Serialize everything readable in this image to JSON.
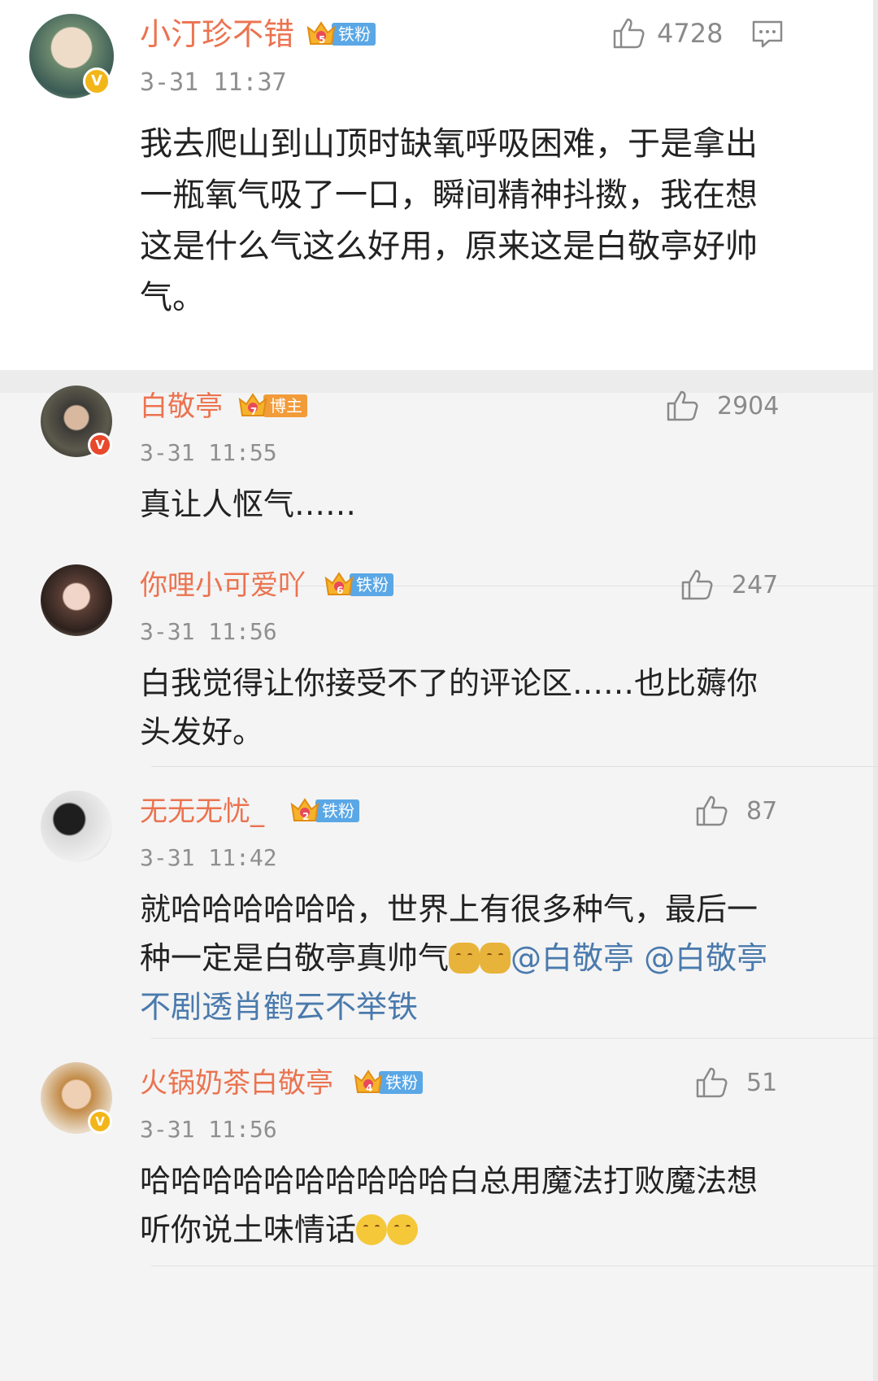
{
  "main_comment": {
    "username": "小汀珍不错",
    "fan_level": "5",
    "fan_tag": "铁粉",
    "time": "3-31 11:37",
    "likes": "4728",
    "text": "我去爬山到山顶时缺氧呼吸困难，于是拿出一瓶氧气吸了一口，瞬间精神抖擞，我在想这是什么气这么好用，原来这是白敬亭好帅气。"
  },
  "replies": [
    {
      "username": "白敬亭",
      "fan_level": "7",
      "fan_tag": "博主",
      "time": "3-31 11:55",
      "likes": "2904",
      "text": "真让人怄气……"
    },
    {
      "username": "你哩小可爱吖",
      "fan_level": "6",
      "fan_tag": "铁粉",
      "time": "3-31 11:56",
      "likes": "247",
      "text": "白我觉得让你接受不了的评论区……也比薅你头发好。"
    },
    {
      "username": "无无无忧_",
      "fan_level": "2",
      "fan_tag": "铁粉",
      "time": "3-31 11:42",
      "likes": "87",
      "text_a": "就哈哈哈哈哈哈，世界上有很多种气，最后一种一定是白敬亭真帅气",
      "mention_a": "@白敬亭",
      "mention_b": "@白敬亭不剧透肖鹤云不举铁"
    },
    {
      "username": "火锅奶茶白敬亭",
      "fan_level": "4",
      "fan_tag": "铁粉",
      "time": "3-31 11:56",
      "likes": "51",
      "text": "哈哈哈哈哈哈哈哈哈哈白总用魔法打败魔法想听你说土味情话"
    }
  ],
  "icons": {
    "like": "thumbs-up-icon",
    "comment": "comment-icon",
    "verified": "verified-badge-icon",
    "crown": "crown-icon"
  },
  "colors": {
    "username": "#eb7350",
    "mention": "#4a7aad",
    "time": "#8f8f8f",
    "fan_tag": "#5aa7e6",
    "owner_tag": "#f29b39",
    "verified": "#f2b619"
  }
}
